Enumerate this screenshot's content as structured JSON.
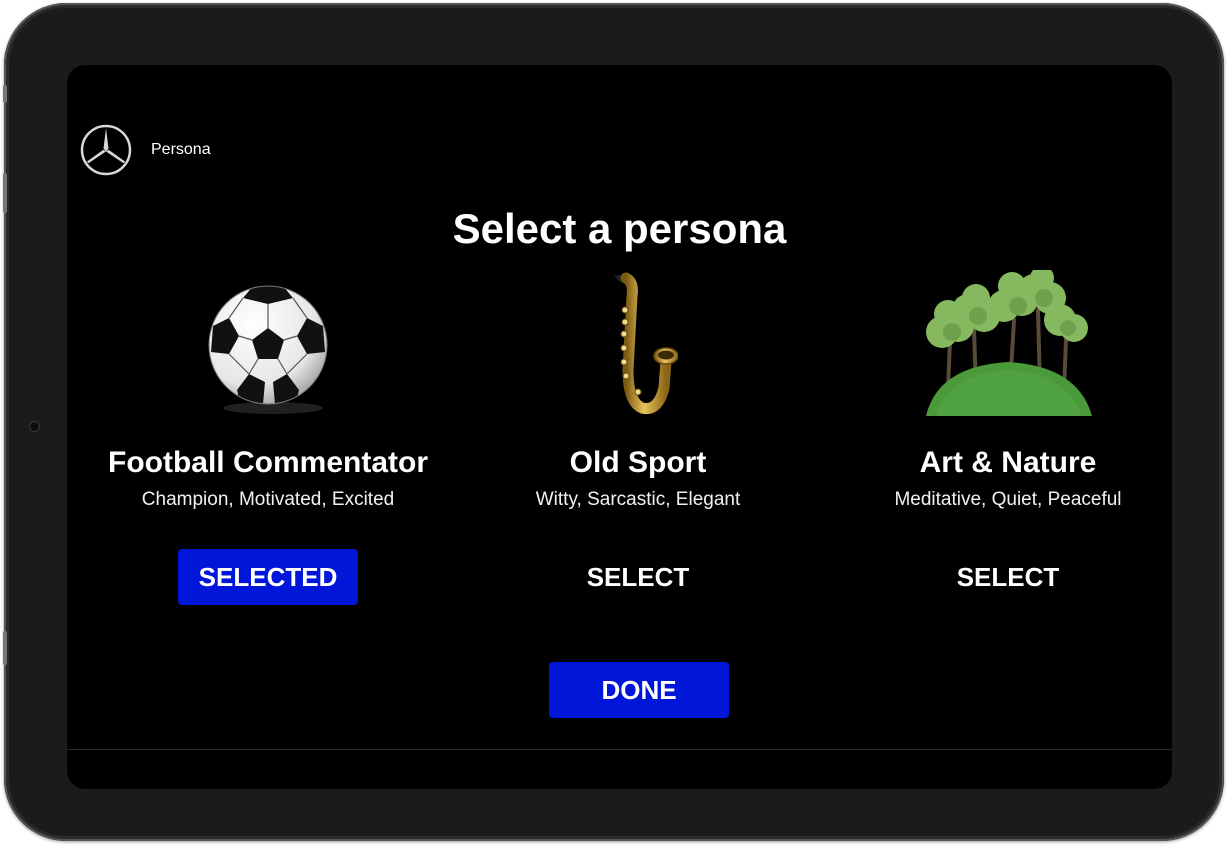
{
  "header": {
    "logo_icon": "three-pointed-star-logo",
    "title": "Persona"
  },
  "main": {
    "title": "Select a persona",
    "personas": [
      {
        "name": "Football Commentator",
        "traits": "Champion, Motivated, Excited",
        "icon": "soccer-ball-icon",
        "button_label": "SELECTED",
        "selected": true
      },
      {
        "name": "Old Sport",
        "traits": "Witty, Sarcastic, Elegant",
        "icon": "saxophone-icon",
        "button_label": "SELECT",
        "selected": false
      },
      {
        "name": "Art & Nature",
        "traits": "Meditative, Quiet, Peaceful",
        "icon": "trees-on-hill-icon",
        "button_label": "SELECT",
        "selected": false
      }
    ],
    "done_label": "DONE"
  },
  "colors": {
    "accent": "#0016d8",
    "background": "#000000",
    "text": "#ffffff"
  }
}
